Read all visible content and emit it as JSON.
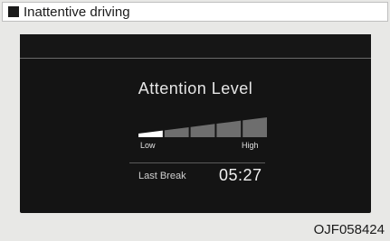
{
  "header": {
    "title": "Inattentive driving"
  },
  "panel": {
    "title": "Attention Level",
    "meter": {
      "level_segments": 1,
      "total_segments": 5,
      "active_color": "#ffffff",
      "inactive_color": "#6e6e6e",
      "low_label": "Low",
      "high_label": "High"
    },
    "last_break": {
      "label": "Last Break",
      "value": "05:27"
    }
  },
  "figure_code": "OJF058424"
}
